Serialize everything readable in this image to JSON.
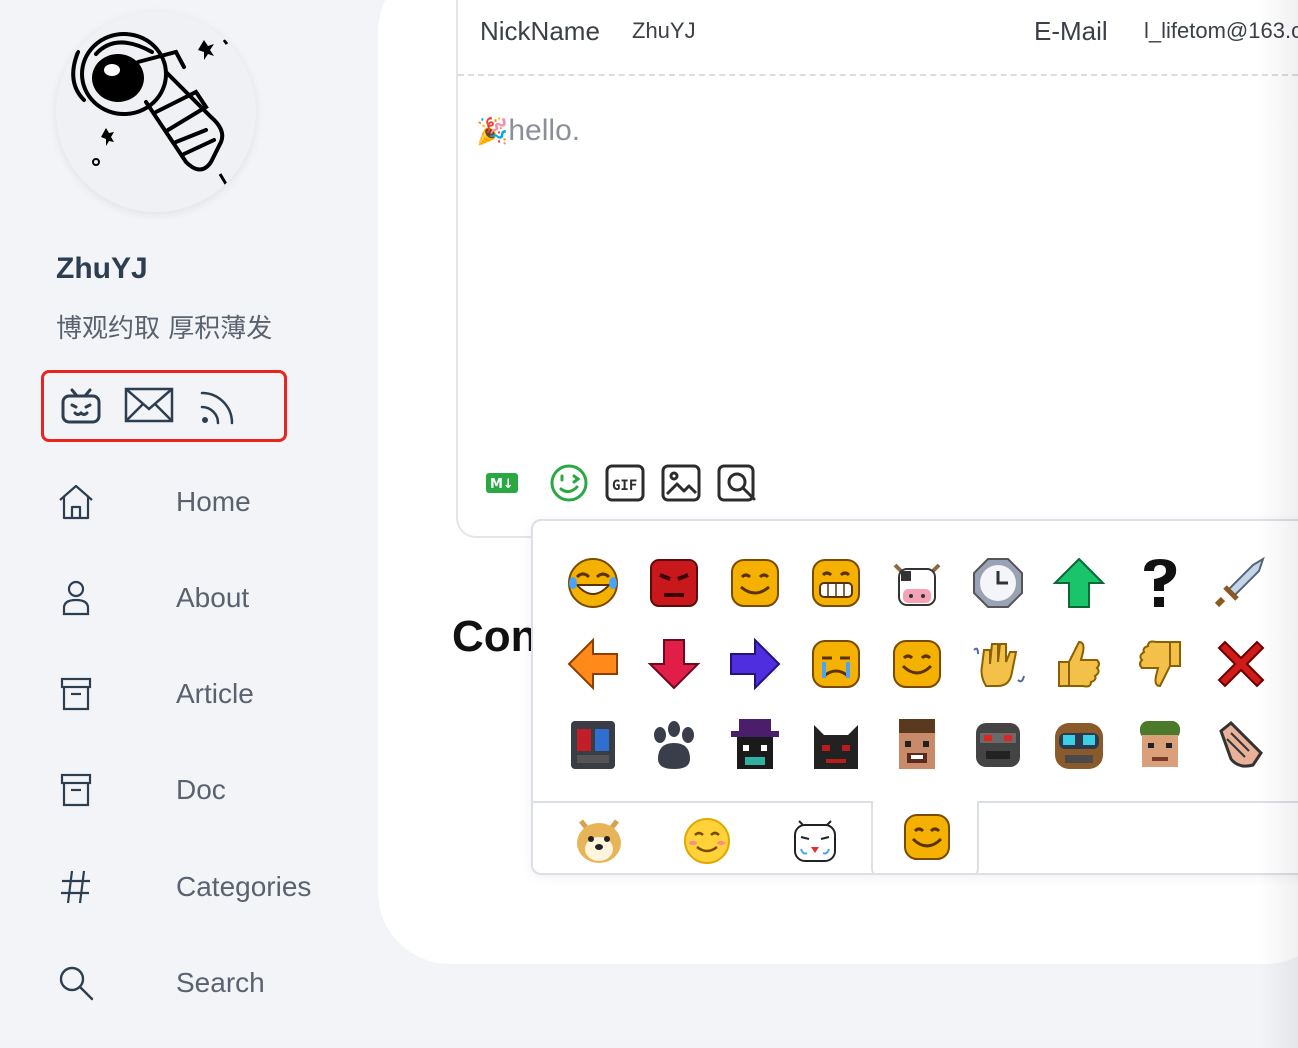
{
  "profile": {
    "name": "ZhuYJ",
    "motto": "博观约取 厚积薄发"
  },
  "social": [
    "bilibili-icon",
    "mail-icon",
    "rss-icon"
  ],
  "nav": [
    {
      "label": "Home",
      "icon": "home-icon"
    },
    {
      "label": "About",
      "icon": "user-icon"
    },
    {
      "label": "Article",
      "icon": "archive-icon"
    },
    {
      "label": "Doc",
      "icon": "archive-icon"
    },
    {
      "label": "Categories",
      "icon": "hash-icon"
    },
    {
      "label": "Search",
      "icon": "search-icon"
    }
  ],
  "comment": {
    "nickname_label": "NickName",
    "nickname_value": "ZhuYJ",
    "email_label": "E-Mail",
    "email_value": "l_lifetom@163.c",
    "content": "hello.",
    "content_prefix_emoji": "🎉"
  },
  "toolbar": [
    "markdown-icon",
    "emoji-icon",
    "gif-icon",
    "image-icon",
    "preview-icon"
  ],
  "comments_heading": "Con",
  "emoji_panel": {
    "rows": [
      [
        "laughing",
        "angry",
        "smile",
        "grin",
        "cow",
        "clock",
        "arrow-up",
        "question",
        "sword"
      ],
      [
        "arrow-left",
        "arrow-down",
        "arrow-right",
        "cry",
        "happy",
        "wave",
        "thumbs-up",
        "thumbs-down",
        "cross"
      ],
      [
        "monster-tv",
        "paw",
        "villager-hat",
        "dark-cat",
        "cowboy",
        "robot",
        "goggles",
        "soldier",
        "hand"
      ]
    ],
    "tabs": [
      "doge",
      "qq",
      "bilibili-tv",
      "pixel"
    ],
    "active_tab": 3
  }
}
